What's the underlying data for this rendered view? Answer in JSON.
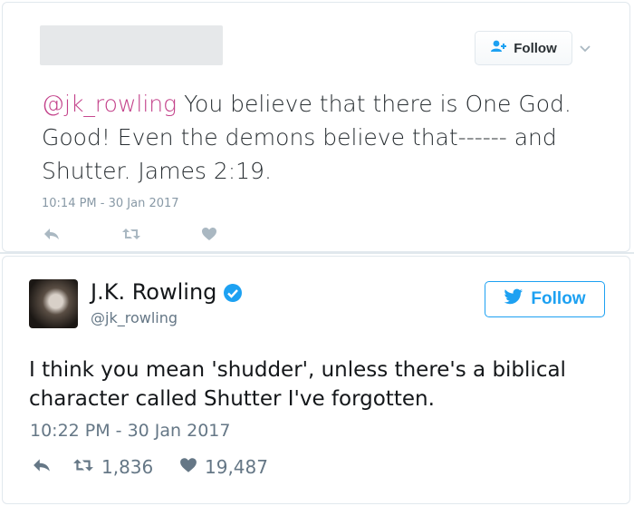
{
  "reply_tweet": {
    "follow_label": "Follow",
    "mention": "@jk_rowling",
    "text": " You believe that there is One God. Good! Even the demons believe that------ and Shutter. James 2:19.",
    "timestamp": "10:14 PM - 30 Jan 2017"
  },
  "main_tweet": {
    "display_name": "J.K. Rowling",
    "handle": "@jk_rowling",
    "follow_label": "Follow",
    "text": "I think you mean 'shudder', unless there's a biblical character called Shutter I've forgotten.",
    "timestamp": "10:22 PM - 30 Jan 2017",
    "retweet_count": "1,836",
    "like_count": "19,487"
  },
  "colors": {
    "mention": "#c3418a",
    "twitter_blue": "#1da1f2",
    "muted": "#657786"
  }
}
